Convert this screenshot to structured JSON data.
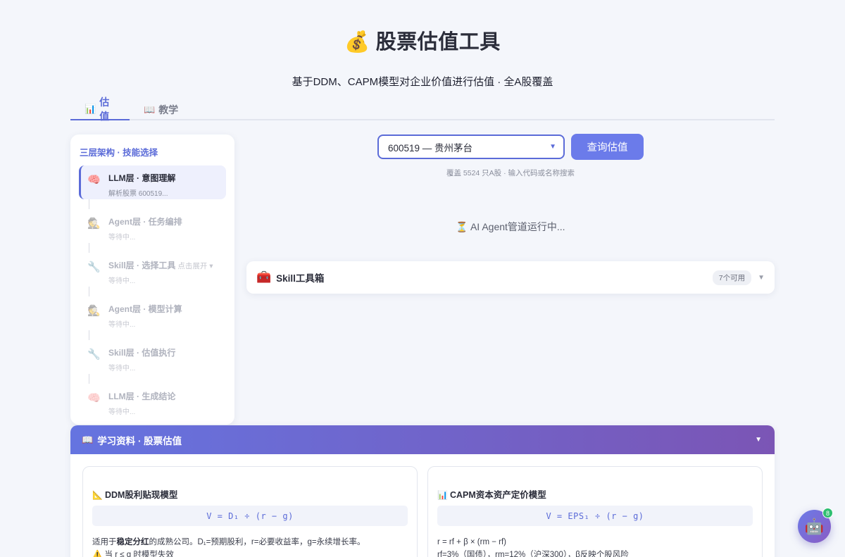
{
  "header": {
    "emoji": "💰",
    "title": "股票估值工具",
    "subtitle": "基于DDM、CAPM模型对企业价值进行估值 · 全A股覆盖"
  },
  "tabs": [
    {
      "icon": "📊",
      "label": "估值",
      "active": true
    },
    {
      "icon": "📖",
      "label": "教学",
      "active": false
    }
  ],
  "sidebar": {
    "title": "三层架构 · 技能选择",
    "steps": [
      {
        "icon": "🧠",
        "label": "LLM层 · 意图理解",
        "sub": "解析股票 600519...",
        "state": "active"
      },
      {
        "icon": "🕵️",
        "label": "Agent层 · 任务编排",
        "sub": "等待中...",
        "state": "pending"
      },
      {
        "icon": "🔧",
        "label": "Skill层 · 选择工具",
        "hint": "点击展开 ▾",
        "sub": "等待中...",
        "state": "pending"
      },
      {
        "icon": "🕵️",
        "label": "Agent层 · 模型计算",
        "sub": "等待中...",
        "state": "pending"
      },
      {
        "icon": "🔧",
        "label": "Skill层 · 估值执行",
        "sub": "等待中...",
        "state": "pending"
      },
      {
        "icon": "🧠",
        "label": "LLM层 · 生成结论",
        "sub": "等待中...",
        "state": "pending"
      }
    ]
  },
  "search": {
    "selected": "600519 — 贵州茅台",
    "button": "查询估值",
    "coverage": "覆盖 5524 只A股 · 输入代码或名称搜索"
  },
  "status": {
    "running": "⏳ AI Agent管道运行中..."
  },
  "toolbox": {
    "icon": "🧰",
    "title": "Skill工具箱",
    "badge": "7个可用"
  },
  "learning": {
    "icon": "📖",
    "title": "学习资料 · 股票估值",
    "cards": [
      {
        "icon": "📐",
        "title": "DDM股利贴现模型",
        "formula": "V = D₁ ÷ (r − g)",
        "text_prefix": "适用于",
        "text_bold": "稳定分红",
        "text_suffix": "的成熟公司。D₁=预期股利，r=必要收益率，g=永续增长率。",
        "warning": "⚠️ 当 r ≤ g 时模型失效"
      },
      {
        "icon": "📊",
        "title": "CAPM资本资产定价模型",
        "formula": "V = EPS₁ ÷ (r − g)",
        "line1": "r = rf + β × (rm − rf)",
        "line2": "rf=3%（国债），rm=12%（沪深300），β反映个股风险"
      }
    ]
  },
  "assistant": {
    "icon": "🤖",
    "badge": "8"
  }
}
